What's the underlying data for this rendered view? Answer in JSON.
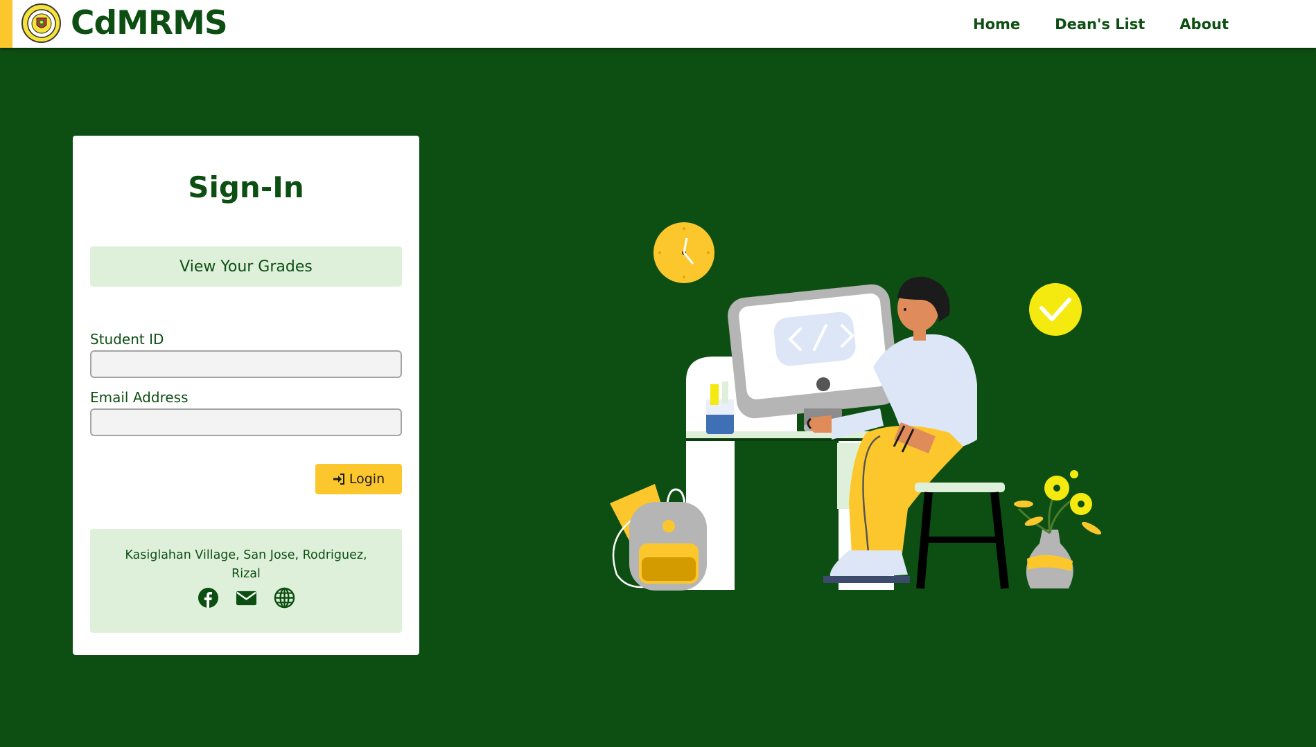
{
  "header": {
    "brand": "CdMRMS",
    "nav": [
      "Home",
      "Dean's List",
      "About"
    ]
  },
  "signin": {
    "title": "Sign-In",
    "subtitle": "View Your Grades",
    "student_id_label": "Student ID",
    "student_id_value": "",
    "email_label": "Email Address",
    "email_value": "",
    "login_label": "Login"
  },
  "footer": {
    "address_line1": "Kasiglahan Village, San Jose, Rodriguez,",
    "address_line2": "Rizal",
    "social_icons": [
      "facebook-icon",
      "envelope-icon",
      "globe-icon"
    ]
  },
  "colors": {
    "primary_green": "#0d4f12",
    "accent_yellow": "#fcc72c",
    "light_green": "#dff0da"
  }
}
